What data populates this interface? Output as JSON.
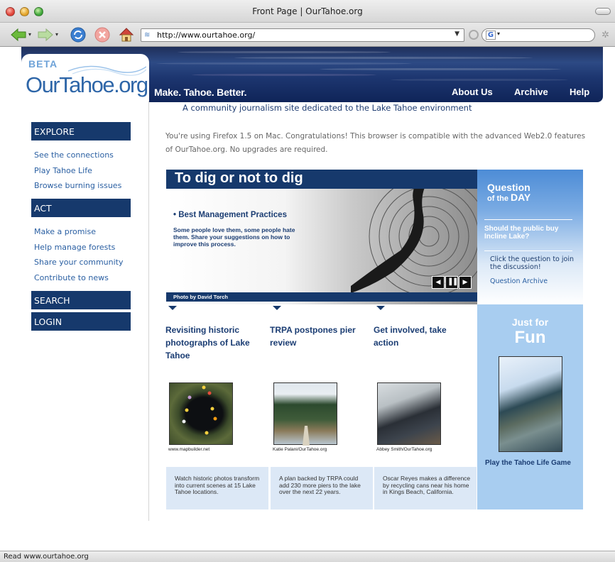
{
  "window": {
    "title": "Front Page | OurTahoe.org"
  },
  "toolbar": {
    "url": "http://www.ourtahoe.org/",
    "search_engine": "G"
  },
  "status_bar": {
    "text": "Read www.ourtahoe.org"
  },
  "site": {
    "logo_beta": "BETA",
    "logo_name": "OurTahoe.org",
    "slogan": "Make. Tahoe. Better.",
    "top_nav": [
      "About Us",
      "Archive",
      "Help"
    ],
    "tagline": "A community journalism site dedicated to the Lake Tahoe environment",
    "compat_notice": "You're using Firefox 1.5 on Mac. Congratulations! This browser is compatible with the advanced Web2.0 features of OurTahoe.org. No upgrades are required."
  },
  "sidebar": {
    "explore": {
      "heading": "EXPLORE",
      "links": [
        "See the connections",
        "Play Tahoe Life",
        "Browse burning issues"
      ]
    },
    "act": {
      "heading": "ACT",
      "links": [
        "Make a promise",
        "Help manage forests",
        "Share your community",
        "Contribute to news"
      ]
    },
    "search": "SEARCH",
    "login": "LOGIN"
  },
  "feature": {
    "title": "To dig or not to dig",
    "bullet": "• Best Management Practices",
    "description": "Some people love them, some people hate them. Share your suggestions on how to improve this process.",
    "credit": "Photo by David Torch",
    "controls": [
      "◀",
      "▐▐",
      "▶"
    ]
  },
  "qotd": {
    "title_1": "Question",
    "title_2a": "of the ",
    "title_2b": "DAY",
    "question": "Should the public buy Incline Lake?",
    "instruction": "Click the question to join the discussion!",
    "archive_link": "Question Archive"
  },
  "fun": {
    "title_1": "Just for",
    "title_2": "Fun",
    "link": "Play the Tahoe Life Game"
  },
  "stories": [
    {
      "title": "Revisiting historic photographs of Lake Tahoe",
      "credit": "www.mapbuilder.net",
      "blurb": "Watch historic photos transform into current scenes at 15 Lake Tahoe locations."
    },
    {
      "title": "TRPA postpones pier review",
      "credit": "Katie Palani/OurTahoe.org",
      "blurb": "A plan backed by TRPA could add 230 more piers to the lake over the next 22 years."
    },
    {
      "title": "Get involved, take action",
      "credit": "Abbey Smith/OurTahoe.org",
      "blurb": "Oscar Reyes makes a difference by recycling cans near his home in Kings Beach, California."
    }
  ],
  "colors": {
    "navy": "#16396c",
    "link_blue": "#2a5fa2",
    "qotd_blue": "#4d8cd6",
    "fun_blue": "#a8cdf0",
    "blurb_bg": "#dce8f6"
  }
}
